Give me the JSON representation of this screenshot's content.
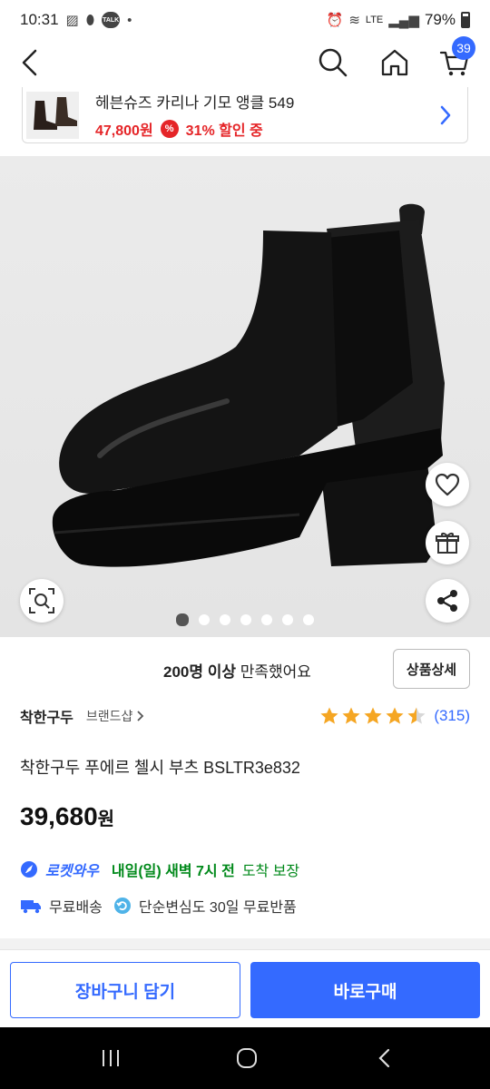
{
  "status_bar": {
    "time": "10:31",
    "battery": "79%",
    "network": "LTE",
    "talk_icon_label": "TALK"
  },
  "header": {
    "cart_count": "39"
  },
  "related_product": {
    "title": "헤븐슈즈 카리나 기모 앵클 549",
    "price": "47,800원",
    "discount_badge": "%",
    "discount_text": "31% 할인 중"
  },
  "gallery": {
    "total_images": 7,
    "active_index": 0
  },
  "satisfaction": {
    "count": "200명 이상",
    "text": " 만족했어요",
    "detail_button": "상품상세"
  },
  "brand": {
    "name": "착한구두",
    "shop_label": "브랜드샵",
    "rating": 4.5,
    "review_count": "(315)"
  },
  "product": {
    "title": "착한구두 푸에르 첼시 부츠 BSLTR3e832",
    "price": "39,680",
    "currency": "원"
  },
  "delivery": {
    "rocket_label": "로켓와우",
    "arrival_bold": "내일(일) 새벽 7시 전",
    "arrival_rest": " 도착 보장",
    "free_shipping": "무료배송",
    "free_return": "단순변심도 30일 무료반품"
  },
  "actions": {
    "add_to_cart": "장바구니 담기",
    "buy_now": "바로구매"
  },
  "colors": {
    "accent": "#346aff",
    "discount": "#e52528",
    "arrival": "#00891a",
    "star": "#f5a623"
  }
}
